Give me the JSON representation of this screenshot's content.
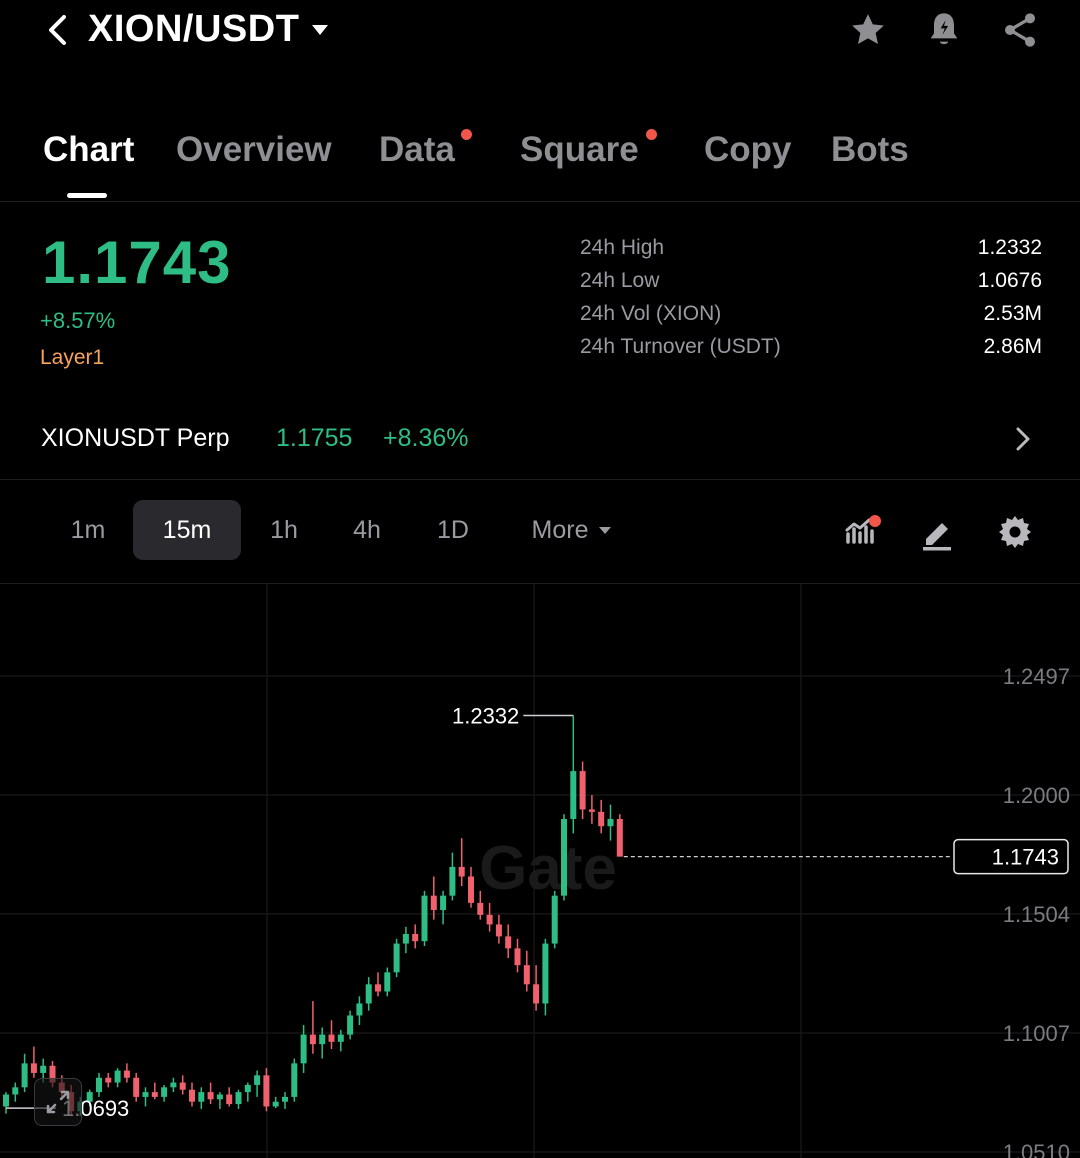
{
  "header": {
    "pair": "XION/USDT",
    "icons": [
      "back-icon",
      "caret-down-icon",
      "star-icon",
      "bell-alert-icon",
      "share-icon"
    ]
  },
  "tabs": [
    {
      "label": "Chart",
      "active": true,
      "dot": false
    },
    {
      "label": "Overview",
      "active": false,
      "dot": false
    },
    {
      "label": "Data",
      "active": false,
      "dot": true
    },
    {
      "label": "Square",
      "active": false,
      "dot": true
    },
    {
      "label": "Copy",
      "active": false,
      "dot": false
    },
    {
      "label": "Bots",
      "active": false,
      "dot": false
    }
  ],
  "ticker": {
    "price": "1.1743",
    "change": "+8.57%",
    "tag": "Layer1"
  },
  "stats": [
    {
      "label": "24h High",
      "value": "1.2332"
    },
    {
      "label": "24h Low",
      "value": "1.0676"
    },
    {
      "label": "24h Vol (XION)",
      "value": "2.53M"
    },
    {
      "label": "24h Turnover (USDT)",
      "value": "2.86M"
    }
  ],
  "perp": {
    "name": "XIONUSDT Perp",
    "price": "1.1755",
    "change": "+8.36%"
  },
  "intervals": {
    "items": [
      "1m",
      "15m",
      "1h",
      "4h",
      "1D"
    ],
    "active": "15m",
    "more": "More"
  },
  "chart_data": {
    "type": "candlestick",
    "watermark": "Gate",
    "y_ticks": [
      "1.2497",
      "1.2000",
      "1.1504",
      "1.1007",
      "1.0510"
    ],
    "ylim": [
      1.051,
      1.2497
    ],
    "current_price": "1.1743",
    "high_marker": "1.2332",
    "low_marker": "1.0693",
    "colors": {
      "up": "#2ebd85",
      "down": "#f0616d"
    },
    "candles": [
      [
        1.07,
        1.076,
        1.067,
        1.075
      ],
      [
        1.075,
        1.08,
        1.072,
        1.078
      ],
      [
        1.078,
        1.092,
        1.076,
        1.088
      ],
      [
        1.088,
        1.095,
        1.082,
        1.084
      ],
      [
        1.084,
        1.09,
        1.08,
        1.087
      ],
      [
        1.087,
        1.089,
        1.078,
        1.08
      ],
      [
        1.08,
        1.083,
        1.074,
        1.076
      ],
      [
        1.076,
        1.079,
        1.066,
        1.068
      ],
      [
        1.068,
        1.074,
        1.066,
        1.072
      ],
      [
        1.072,
        1.077,
        1.07,
        1.076
      ],
      [
        1.076,
        1.084,
        1.074,
        1.082
      ],
      [
        1.082,
        1.084,
        1.078,
        1.08
      ],
      [
        1.08,
        1.086,
        1.078,
        1.085
      ],
      [
        1.085,
        1.088,
        1.08,
        1.082
      ],
      [
        1.082,
        1.084,
        1.072,
        1.074
      ],
      [
        1.074,
        1.078,
        1.07,
        1.076
      ],
      [
        1.076,
        1.08,
        1.073,
        1.074
      ],
      [
        1.074,
        1.079,
        1.072,
        1.078
      ],
      [
        1.078,
        1.082,
        1.076,
        1.08
      ],
      [
        1.08,
        1.083,
        1.075,
        1.077
      ],
      [
        1.077,
        1.08,
        1.07,
        1.072
      ],
      [
        1.072,
        1.078,
        1.069,
        1.076
      ],
      [
        1.076,
        1.08,
        1.071,
        1.073
      ],
      [
        1.073,
        1.076,
        1.069,
        1.075
      ],
      [
        1.075,
        1.078,
        1.07,
        1.071
      ],
      [
        1.071,
        1.077,
        1.069,
        1.076
      ],
      [
        1.076,
        1.08,
        1.072,
        1.079
      ],
      [
        1.079,
        1.085,
        1.074,
        1.083
      ],
      [
        1.083,
        1.086,
        1.068,
        1.07
      ],
      [
        1.07,
        1.074,
        1.0693,
        1.072
      ],
      [
        1.072,
        1.076,
        1.069,
        1.074
      ],
      [
        1.074,
        1.09,
        1.072,
        1.088
      ],
      [
        1.088,
        1.104,
        1.084,
        1.1
      ],
      [
        1.1,
        1.114,
        1.092,
        1.096
      ],
      [
        1.096,
        1.103,
        1.09,
        1.1
      ],
      [
        1.1,
        1.106,
        1.094,
        1.097
      ],
      [
        1.097,
        1.102,
        1.093,
        1.1
      ],
      [
        1.1,
        1.11,
        1.098,
        1.108
      ],
      [
        1.108,
        1.116,
        1.104,
        1.113
      ],
      [
        1.113,
        1.124,
        1.11,
        1.121
      ],
      [
        1.121,
        1.126,
        1.116,
        1.118
      ],
      [
        1.118,
        1.128,
        1.116,
        1.126
      ],
      [
        1.126,
        1.14,
        1.124,
        1.138
      ],
      [
        1.138,
        1.145,
        1.134,
        1.142
      ],
      [
        1.142,
        1.146,
        1.136,
        1.139
      ],
      [
        1.139,
        1.16,
        1.137,
        1.158
      ],
      [
        1.158,
        1.166,
        1.148,
        1.152
      ],
      [
        1.152,
        1.16,
        1.146,
        1.158
      ],
      [
        1.158,
        1.176,
        1.156,
        1.17
      ],
      [
        1.17,
        1.182,
        1.162,
        1.166
      ],
      [
        1.166,
        1.17,
        1.153,
        1.155
      ],
      [
        1.155,
        1.16,
        1.148,
        1.15
      ],
      [
        1.15,
        1.155,
        1.143,
        1.146
      ],
      [
        1.146,
        1.15,
        1.138,
        1.141
      ],
      [
        1.141,
        1.146,
        1.132,
        1.136
      ],
      [
        1.136,
        1.14,
        1.126,
        1.129
      ],
      [
        1.129,
        1.135,
        1.118,
        1.121
      ],
      [
        1.121,
        1.129,
        1.11,
        1.113
      ],
      [
        1.113,
        1.14,
        1.108,
        1.138
      ],
      [
        1.138,
        1.16,
        1.136,
        1.158
      ],
      [
        1.158,
        1.192,
        1.156,
        1.19
      ],
      [
        1.19,
        1.2332,
        1.184,
        1.21
      ],
      [
        1.21,
        1.214,
        1.19,
        1.194
      ],
      [
        1.194,
        1.2,
        1.188,
        1.193
      ],
      [
        1.193,
        1.198,
        1.184,
        1.187
      ],
      [
        1.187,
        1.196,
        1.181,
        1.19
      ],
      [
        1.19,
        1.192,
        1.1743,
        1.1743
      ]
    ]
  }
}
